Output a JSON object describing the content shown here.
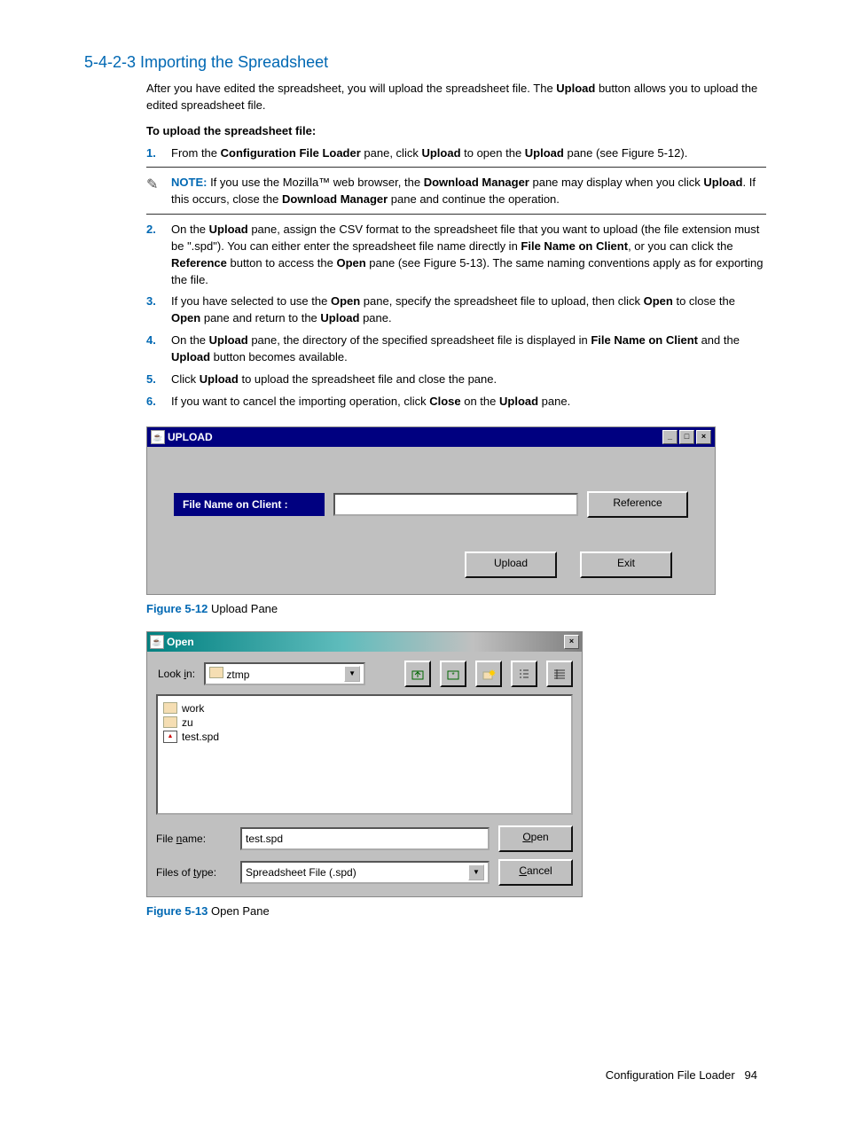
{
  "section_title": "5-4-2-3 Importing the Spreadsheet",
  "intro_before": "After you have edited the spreadsheet, you will upload the spreadsheet file. The ",
  "intro_bold": "Upload",
  "intro_after": " button allows you to upload the edited spreadsheet file.",
  "subhead": "To upload the spreadsheet file:",
  "step1": {
    "num": "1.",
    "a": "From the ",
    "b1": "Configuration File Loader",
    "c": " pane, click ",
    "b2": "Upload",
    "d": " to open the ",
    "b3": "Upload",
    "e": " pane (see Figure 5-12)."
  },
  "note": {
    "label": "NOTE:",
    "a": "  If you use the Mozilla™ web browser, the ",
    "b1": "Download Manager",
    "c": " pane may display when you click ",
    "b2": "Upload",
    "d": ". If this occurs, close the ",
    "b3": "Download Manager",
    "e": " pane and continue the operation."
  },
  "step2": {
    "num": "2.",
    "a": "On the ",
    "b1": "Upload",
    "c": " pane, assign the CSV format to the spreadsheet file that you want to upload (the file extension must be \".spd\"). You can either enter the spreadsheet file name directly in ",
    "b2": "File Name on Client",
    "d": ", or you can click the ",
    "b3": "Reference",
    "e": " button to access the ",
    "b4": "Open",
    "f": " pane (see Figure 5-13). The same naming conventions apply as for exporting the file."
  },
  "step3": {
    "num": "3.",
    "a": "If you have selected to use the ",
    "b1": "Open",
    "c": " pane, specify the spreadsheet file to upload, then click ",
    "b2": "Open",
    "d": " to close the ",
    "b3": "Open",
    "e": " pane and return to the ",
    "b4": "Upload",
    "f": " pane."
  },
  "step4": {
    "num": "4.",
    "a": "On the ",
    "b1": "Upload",
    "c": " pane, the directory of the specified spreadsheet file is displayed in ",
    "b2": "File Name on Client",
    "d": " and the ",
    "b3": "Upload",
    "e": " button becomes available."
  },
  "step5": {
    "num": "5.",
    "a": "Click ",
    "b1": "Upload",
    "c": " to upload the spreadsheet file and close the pane."
  },
  "step6": {
    "num": "6.",
    "a": "If you want to cancel the importing operation, click ",
    "b1": "Close",
    "c": " on the ",
    "b2": "Upload",
    "d": " pane."
  },
  "upload_dialog": {
    "title": "UPLOAD",
    "min": "_",
    "max": "□",
    "close": "×",
    "field_label": "File Name on Client :",
    "reference": "Reference",
    "upload": "Upload",
    "exit": "Exit"
  },
  "fig512": {
    "label": "Figure 5-12",
    "text": " Upload Pane"
  },
  "open_dialog": {
    "title": "Open",
    "close": "×",
    "lookin_u": "i",
    "lookin_pre": "Look ",
    "lookin_post": "n:",
    "folder": "ztmp",
    "items": [
      "work",
      "zu",
      "test.spd"
    ],
    "filename_pre": "File ",
    "filename_u": "n",
    "filename_post": "ame:",
    "filename_val": "test.spd",
    "filesof_pre": "Files of ",
    "filesof_u": "t",
    "filesof_post": "ype:",
    "filesof_val": "Spreadsheet File (.spd)",
    "open_u": "O",
    "open_post": "pen",
    "cancel_u": "C",
    "cancel_post": "ancel"
  },
  "fig513": {
    "label": "Figure 5-13",
    "text": " Open Pane"
  },
  "footer": {
    "text": "Configuration File Loader",
    "page": "94"
  }
}
